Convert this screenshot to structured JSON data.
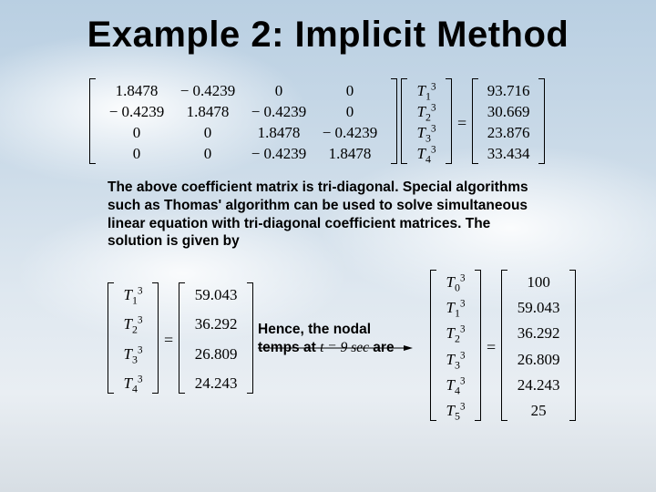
{
  "title": "Example 2: Implicit Method",
  "matrix_A": [
    [
      "1.8478",
      "− 0.4239",
      "0",
      "0"
    ],
    [
      "− 0.4239",
      "1.8478",
      "− 0.4239",
      "0"
    ],
    [
      "0",
      "0",
      "1.8478",
      "− 0.4239"
    ],
    [
      "0",
      "0",
      "− 0.4239",
      "1.8478"
    ]
  ],
  "T_vector_labels": [
    "T₁³",
    "T₂³",
    "T₃³",
    "T₄³"
  ],
  "rhs_vector": [
    "93.716",
    "30.669",
    "23.876",
    "33.434"
  ],
  "paragraph": "The above coefficient matrix is tri-diagonal. Special algorithms such as Thomas' algorithm can be used to solve simultaneous linear equation with tri-diagonal coefficient matrices. The solution is given by",
  "solution_labels": [
    "T₁³",
    "T₂³",
    "T₃³",
    "T₄³"
  ],
  "solution_values": [
    "59.043",
    "36.292",
    "26.809",
    "24.243"
  ],
  "mid_text_1": "Hence, the nodal",
  "mid_text_2_pre": "temps at ",
  "mid_time": "t = 9 sec",
  "mid_text_2_post": " are",
  "full_labels": [
    "T₀³",
    "T₁³",
    "T₂³",
    "T₃³",
    "T₄³",
    "T₅³"
  ],
  "full_values": [
    "100",
    "59.043",
    "36.292",
    "26.809",
    "24.243",
    "25"
  ],
  "equals": "="
}
